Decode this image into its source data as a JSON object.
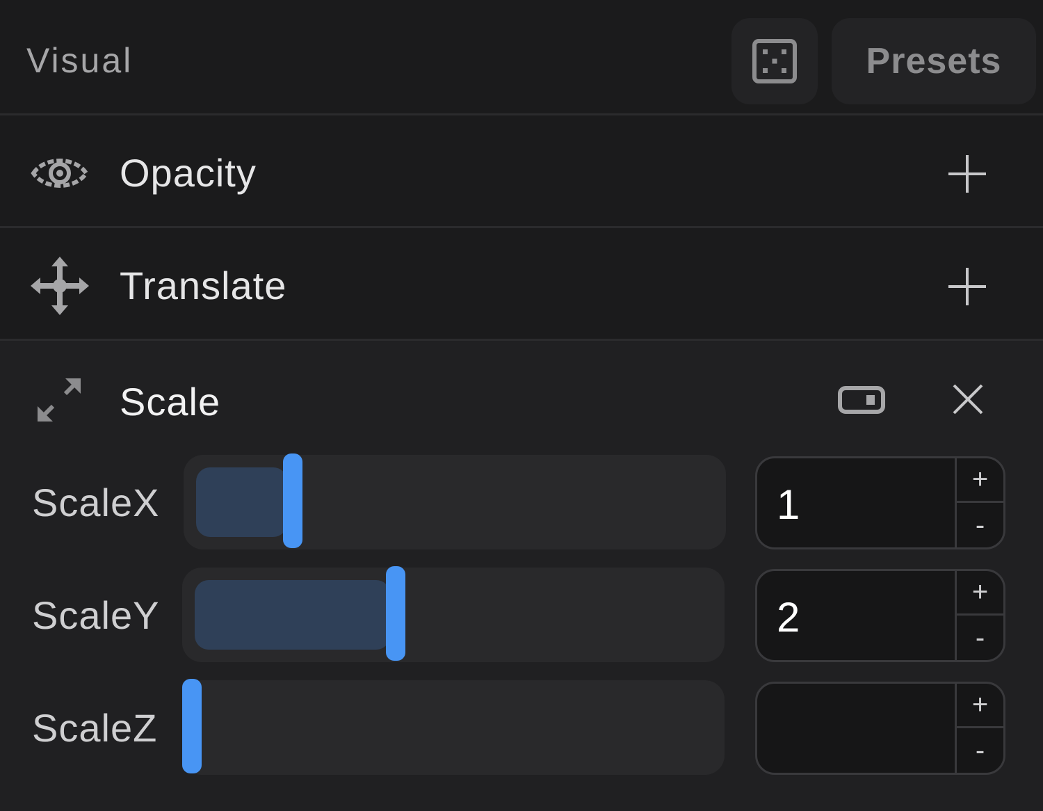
{
  "header": {
    "title": "Visual",
    "presets_label": "Presets"
  },
  "rows": [
    {
      "label": "Opacity",
      "icon": "eye-icon"
    },
    {
      "label": "Translate",
      "icon": "move-icon"
    }
  ],
  "scale": {
    "title": "Scale",
    "accent": "#4895f4",
    "props": [
      {
        "label": "ScaleX",
        "value": "1",
        "slider_fraction": 0.19
      },
      {
        "label": "ScaleY",
        "value": "2",
        "slider_fraction": 0.39
      },
      {
        "label": "ScaleZ",
        "value": "",
        "slider_fraction": 0.0
      }
    ],
    "step_up": "+",
    "step_down": "-"
  }
}
